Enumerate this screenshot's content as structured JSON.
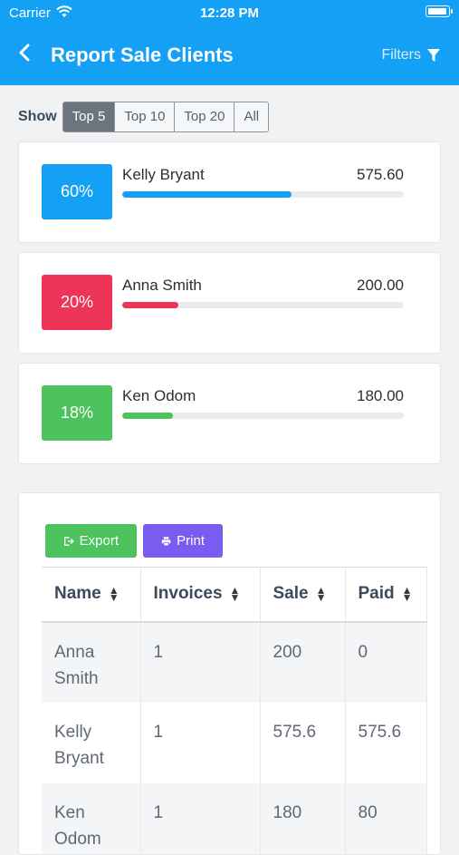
{
  "status_bar": {
    "carrier": "Carrier",
    "time": "12:28 PM"
  },
  "header": {
    "title": "Report Sale Clients",
    "filters_label": "Filters"
  },
  "show": {
    "label": "Show",
    "options": [
      "Top 5",
      "Top 10",
      "Top 20",
      "All"
    ],
    "selected": "Top 5"
  },
  "clients": [
    {
      "name": "Kelly Bryant",
      "amount": "575.60",
      "percent_label": "60%",
      "percent": 60,
      "color": "#14a0f5"
    },
    {
      "name": "Anna Smith",
      "amount": "200.00",
      "percent_label": "20%",
      "percent": 20,
      "color": "#ef3459"
    },
    {
      "name": "Ken Odom",
      "amount": "180.00",
      "percent_label": "18%",
      "percent": 18,
      "color": "#4cc35c"
    }
  ],
  "actions": {
    "export_label": "Export",
    "print_label": "Print"
  },
  "table": {
    "columns": [
      "Name",
      "Invoices",
      "Sale",
      "Paid"
    ],
    "rows": [
      [
        "Anna Smith",
        "1",
        "200",
        "0"
      ],
      [
        "Kelly Bryant",
        "1",
        "575.6",
        "575.6"
      ],
      [
        "Ken Odom",
        "1",
        "180",
        "80"
      ]
    ]
  }
}
